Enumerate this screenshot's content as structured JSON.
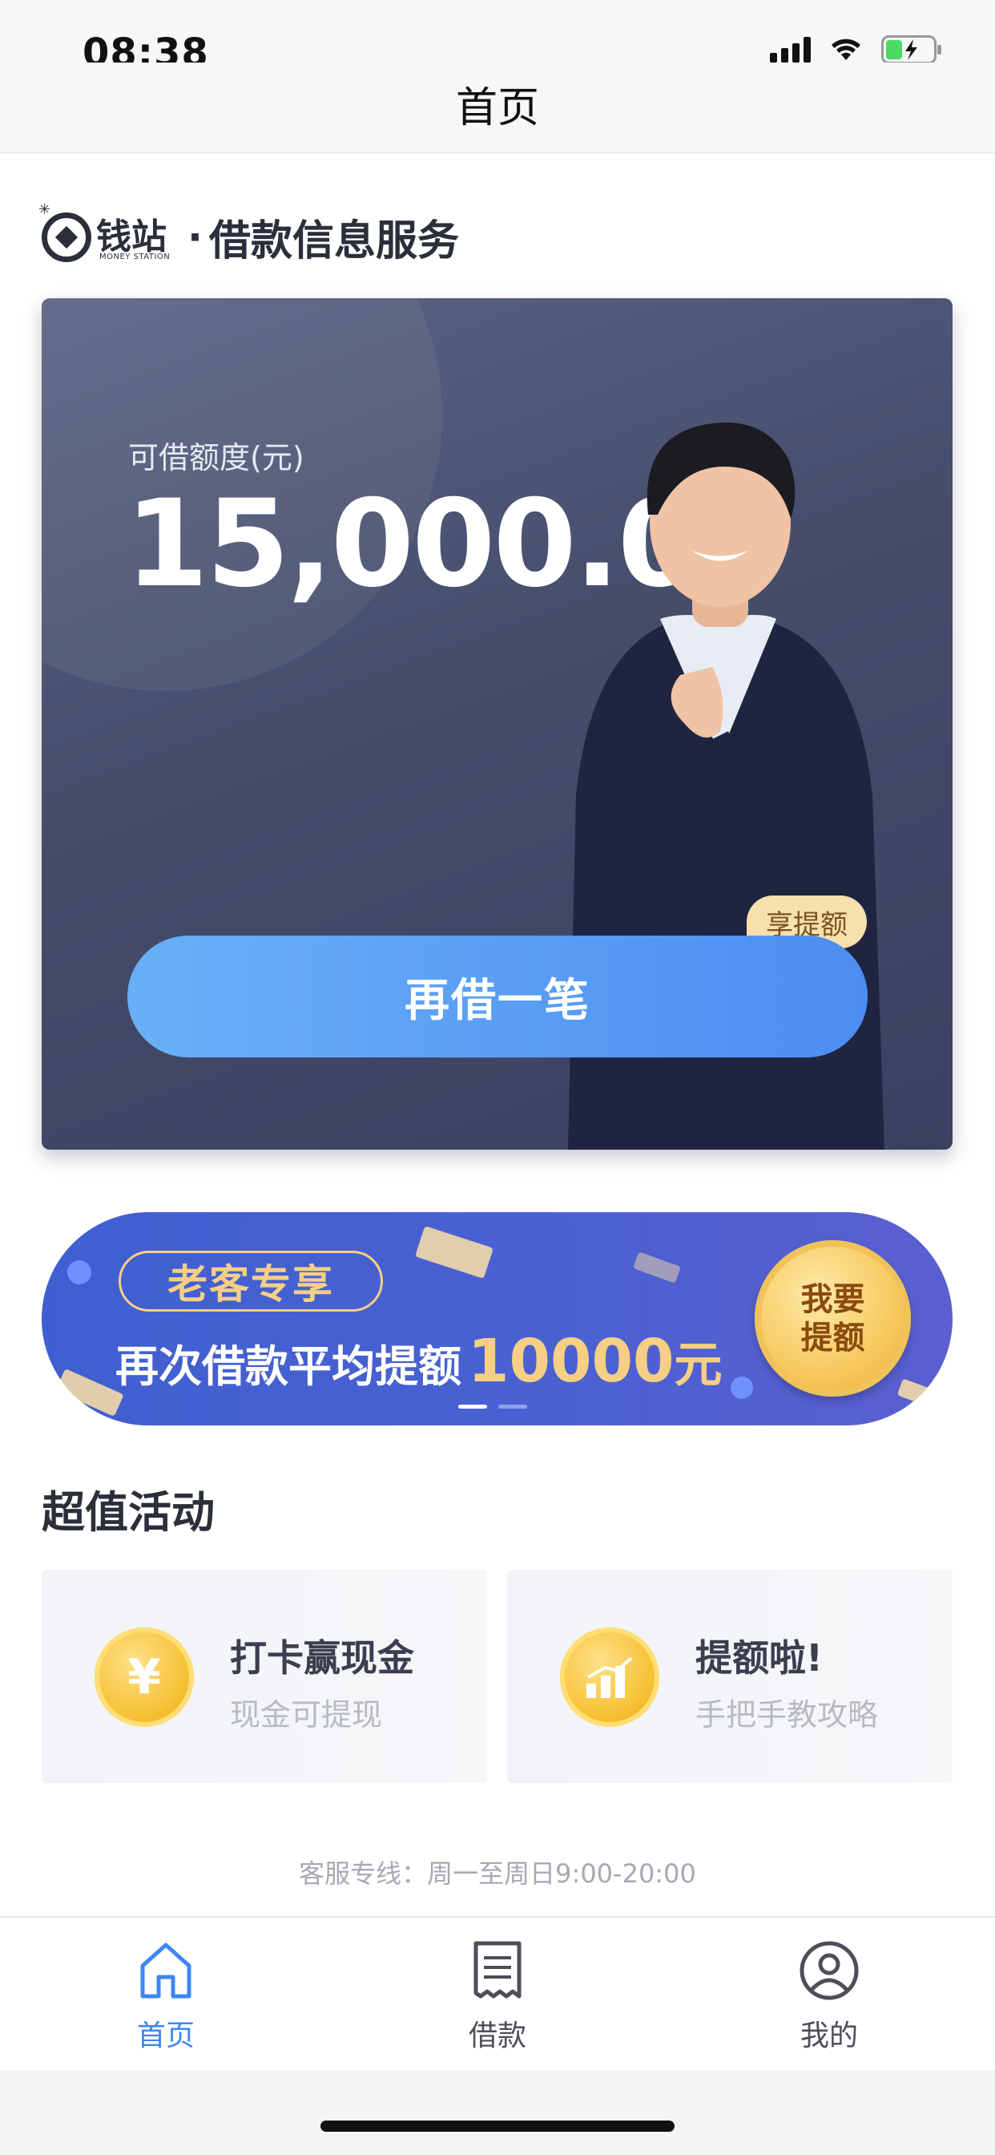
{
  "status_bar": {
    "time": "08:38"
  },
  "nav": {
    "title": "首页"
  },
  "brand": {
    "logo_cn": "钱站",
    "logo_en": "MONEY STATION",
    "separator": "·",
    "title": "借款信息服务"
  },
  "loan_card": {
    "credit_label": "可借额度(元)",
    "credit_amount": "15,000.00",
    "borrow_button": "再借一笔",
    "raise_tag": "享提额"
  },
  "promo": {
    "tag": "老客专享",
    "lead_text": "再次借款平均提额",
    "amount": "10000",
    "unit": "元",
    "coin_text": "我要提额"
  },
  "activities": {
    "section_title": "超值活动",
    "items": [
      {
        "title": "打卡赢现金",
        "subtitle": "现金可提现",
        "icon_symbol": "¥",
        "icon": "coin-yen-icon"
      },
      {
        "title": "提额啦!",
        "subtitle": "手把手教攻略",
        "icon_symbol": "",
        "icon": "bar-chart-coin-icon"
      }
    ]
  },
  "hotline": "客服专线：周一至周日9:00-20:00",
  "tab_bar": {
    "items": [
      {
        "label": "首页",
        "icon": "home-icon",
        "active": true
      },
      {
        "label": "借款",
        "icon": "receipt-icon",
        "active": false
      },
      {
        "label": "我的",
        "icon": "user-icon",
        "active": false
      }
    ]
  },
  "colors": {
    "accent": "#3f86f0",
    "card_bg": "#454d6b",
    "promo_bg": "#4a61d2",
    "gold": "#f6cf85"
  }
}
